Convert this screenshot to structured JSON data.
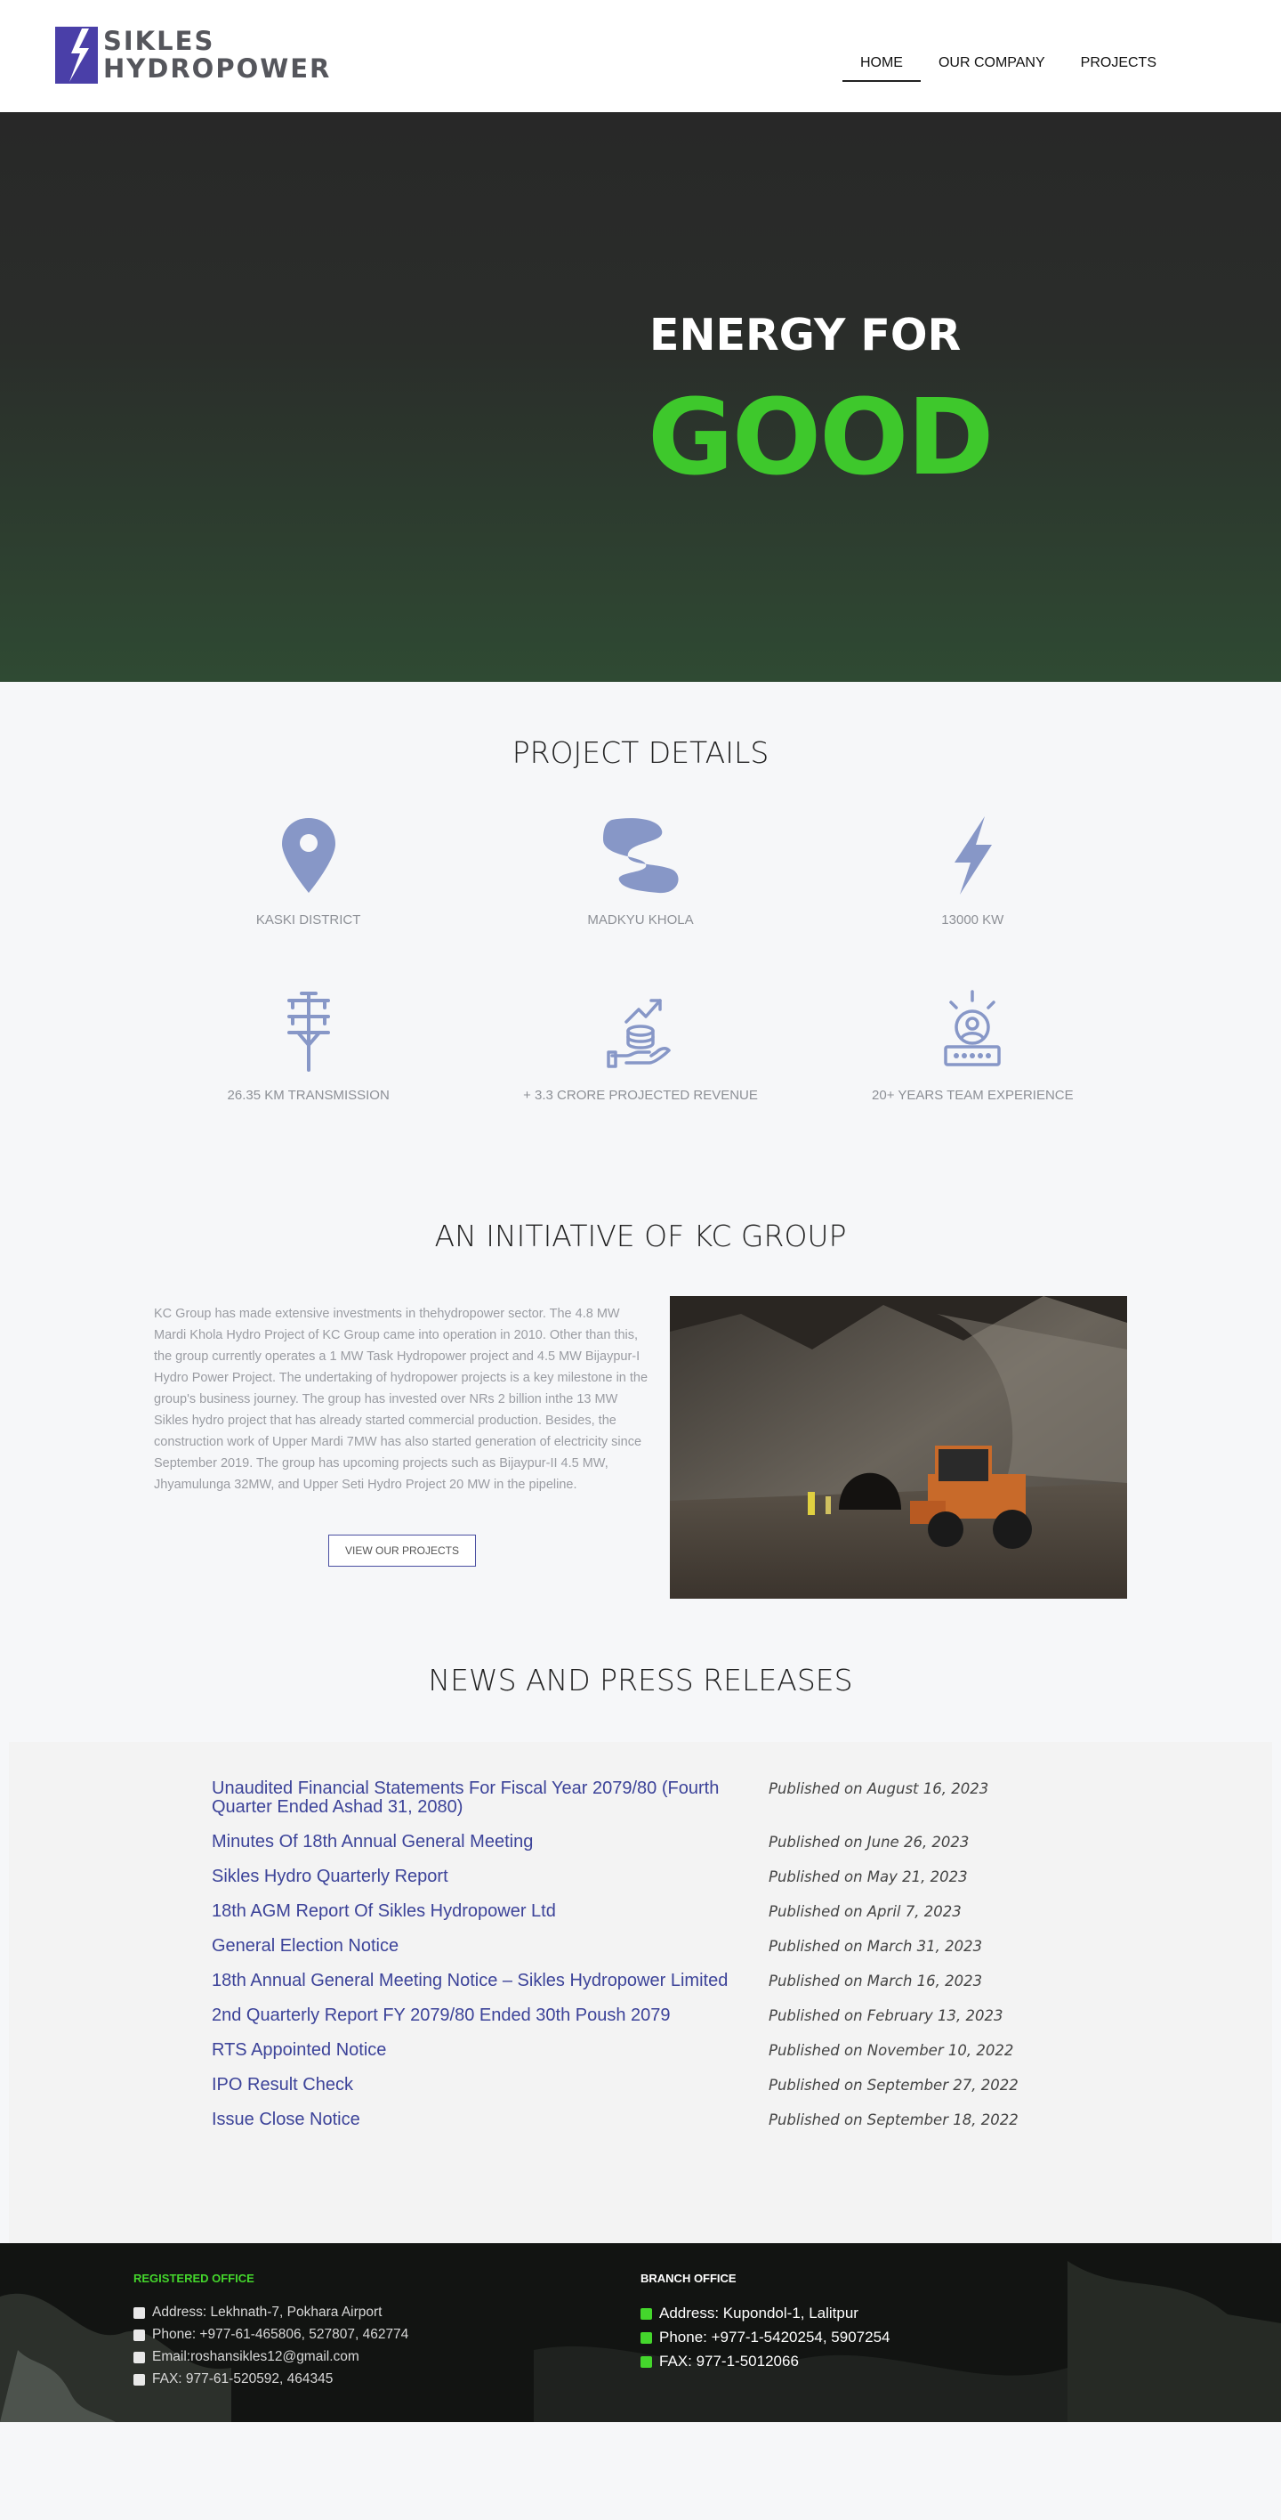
{
  "brand": {
    "line1": "SIKLES",
    "line2": "HYDROPOWER",
    "color": "#4a3fa8"
  },
  "nav": [
    {
      "label": "HOME",
      "active": true
    },
    {
      "label": "OUR COMPANY",
      "active": false
    },
    {
      "label": "PROJECTS",
      "active": false
    }
  ],
  "hero": {
    "line1": "ENERGY FOR",
    "line2": "GOOD",
    "accent": "#3ec82c"
  },
  "details": {
    "title": "PROJECT DETAILS",
    "icon_color": "#8797c7",
    "items": [
      {
        "icon": "map-pin-icon",
        "label": "KASKI DISTRICT"
      },
      {
        "icon": "river-icon",
        "label": "MADKYU KHOLA"
      },
      {
        "icon": "lightning-icon",
        "label": "13000 KW"
      },
      {
        "icon": "transmission-tower-icon",
        "label": "26.35 KM TRANSMISSION"
      },
      {
        "icon": "revenue-coins-icon",
        "label": "+ 3.3 CRORE PROJECTED REVENUE"
      },
      {
        "icon": "team-experience-icon",
        "label": "20+ YEARS TEAM EXPERIENCE"
      }
    ]
  },
  "initiative": {
    "title": "AN INITIATIVE OF KC GROUP",
    "body": "KC Group has made extensive investments in thehydropower sector. The 4.8 MW Mardi Khola Hydro Project of KC Group came into operation in 2010. Other than this, the group currently operates a 1 MW Task Hydropower project and 4.5 MW Bijaypur-I Hydro Power Project. The undertaking of hydropower projects is a key milestone in the group's business journey. The group has invested over NRs 2 billion inthe 13 MW Sikles hydro project that has already started commercial production. Besides, the construction work of Upper Mardi 7MW has also started generation of electricity since September 2019. The group has upcoming projects such as Bijaypur-II 4.5 MW, Jhyamulunga 32MW, and Upper Seti Hydro Project 20 MW in the pipeline.",
    "button": "VIEW OUR PROJECTS"
  },
  "news": {
    "title": "NEWS AND PRESS RELEASES",
    "items": [
      {
        "title": "Unaudited Financial Statements For Fiscal Year 2079/80 (Fourth Quarter Ended Ashad 31, 2080)",
        "date": "Published on August 16, 2023"
      },
      {
        "title": "Minutes Of 18th Annual General Meeting",
        "date": "Published on June 26, 2023"
      },
      {
        "title": "Sikles Hydro Quarterly Report",
        "date": "Published on May 21, 2023"
      },
      {
        "title": "18th AGM Report Of Sikles Hydropower Ltd",
        "date": "Published on April 7, 2023"
      },
      {
        "title": "General Election Notice",
        "date": "Published on March 31, 2023"
      },
      {
        "title": "18th Annual General Meeting Notice – Sikles Hydropower Limited",
        "date": "Published on March 16, 2023"
      },
      {
        "title": "2nd Quarterly Report FY 2079/80 Ended 30th Poush 2079",
        "date": "Published on February 13, 2023"
      },
      {
        "title": "RTS Appointed Notice",
        "date": "Published on November 10, 2022"
      },
      {
        "title": "IPO Result Check",
        "date": "Published on September 27, 2022"
      },
      {
        "title": "Issue Close Notice",
        "date": "Published on September 18, 2022"
      }
    ]
  },
  "footer": {
    "registered": {
      "heading": "REGISTERED OFFICE",
      "heading_color": "#44d62c",
      "lines": [
        {
          "icon": "building-icon",
          "text": "Address: Lekhnath-7, Pokhara Airport"
        },
        {
          "icon": "phone-icon",
          "text": "Phone: +977-61-465806, 527807, 462774"
        },
        {
          "icon": "envelope-icon",
          "text": "Email:roshansikles12@gmail.com"
        },
        {
          "icon": "fax-icon",
          "text": "FAX: 977-61-520592, 464345"
        }
      ]
    },
    "branch": {
      "heading": "BRANCH OFFICE",
      "heading_color": "#ffffff",
      "icon_color": "#44d62c",
      "lines": [
        {
          "icon": "building-icon",
          "text": "Address: Kupondol-1, Lalitpur"
        },
        {
          "icon": "phone-icon",
          "text": "Phone: +977-1-5420254, 5907254"
        },
        {
          "icon": "fax-icon",
          "text": "FAX: 977-1-5012066"
        }
      ]
    }
  }
}
